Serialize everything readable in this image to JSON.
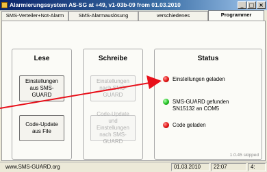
{
  "window": {
    "title": "Alarmierungssystem AS-SG at +49, v1-03b-09 from 01.03.2010",
    "controls": [
      "_",
      "□",
      "×"
    ]
  },
  "tabs": [
    {
      "label": "SMS-Verteiler+Not-Alarm",
      "active": false
    },
    {
      "label": "SMS-Alarmauslösung",
      "active": false
    },
    {
      "label": "verschiedenes",
      "active": false
    },
    {
      "label": "Programmer",
      "active": true
    }
  ],
  "lese": {
    "title": "Lese",
    "buttons": [
      {
        "label": "Einstellungen aus SMS-GUARD",
        "enabled": true
      },
      {
        "label": "Code-Update aus File",
        "enabled": true
      }
    ]
  },
  "schreibe": {
    "title": "Schreibe",
    "buttons": [
      {
        "label": "Einstellungen nach SMS-GUARD",
        "enabled": false
      },
      {
        "label": "Code-Update und Einstellungen nach SMS-GUARD",
        "enabled": false
      }
    ]
  },
  "status": {
    "title": "Status",
    "items": [
      {
        "label": "Einstellungen geladen",
        "led": "red"
      },
      {
        "label": "SMS-GUARD gefunden SN15132 an COM5",
        "led": "green"
      },
      {
        "label": "Code geladen",
        "led": "red"
      }
    ],
    "version": "1.0.45 skipped"
  },
  "statusbar": {
    "website": "www.SMS-GUARD.org",
    "date": "01.03.2010",
    "time": "22:07",
    "extra": "4:"
  },
  "colors": {
    "led_red": "#e01010",
    "led_green": "#20c020",
    "annotation_arrow": "#e8101a"
  }
}
